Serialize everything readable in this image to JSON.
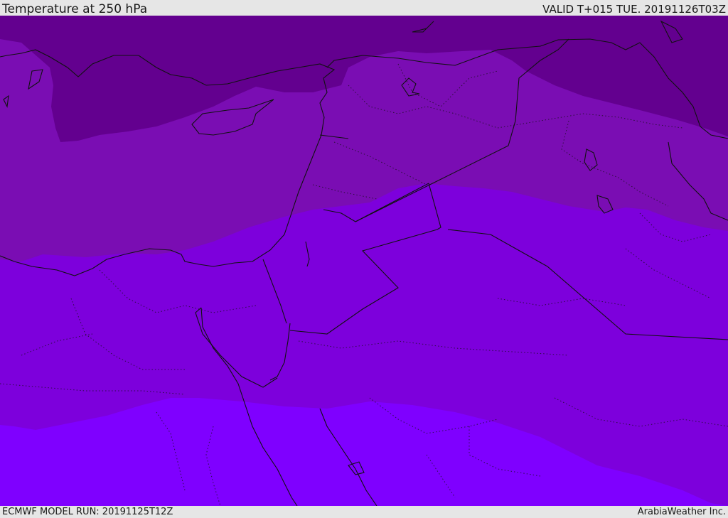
{
  "header": {
    "title": "Temperature at 250 hPa",
    "valid": "VALID T+015 TUE. 20191126T03Z"
  },
  "footer": {
    "model_run": "ECMWF MODEL RUN: 20191125T12Z",
    "credit": "ArabiaWeather Inc."
  },
  "colors": {
    "band_coldest": "#63008f",
    "band_cold": "#7a0db3",
    "band_mid": "#7d00dc",
    "band_warm": "#7f00ff",
    "coastline": "#111111",
    "border": "#111111"
  }
}
